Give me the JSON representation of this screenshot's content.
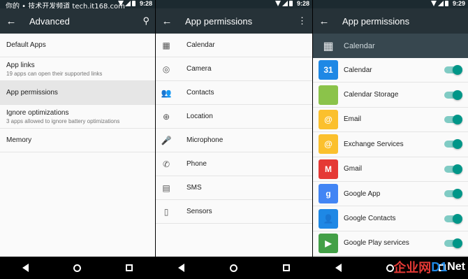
{
  "status": {
    "times": [
      "9:28",
      "9:28",
      "9:29"
    ]
  },
  "watermark": "你的 • 技术开发频道 tech.it168.com",
  "panel1": {
    "title": "Advanced",
    "rows": [
      {
        "title": "Default Apps",
        "sub": ""
      },
      {
        "title": "App links",
        "sub": "19 apps can open their supported links"
      },
      {
        "title": "App permissions",
        "sub": ""
      },
      {
        "title": "Ignore optimizations",
        "sub": "3 apps allowed to ignore battery optimizations"
      },
      {
        "title": "Memory",
        "sub": ""
      }
    ]
  },
  "panel2": {
    "title": "App permissions",
    "rows": [
      "Calendar",
      "Camera",
      "Contacts",
      "Location",
      "Microphone",
      "Phone",
      "SMS",
      "Sensors"
    ]
  },
  "panel3": {
    "title": "App permissions",
    "header": "Calendar",
    "apps": [
      {
        "name": "Calendar",
        "icon": "31",
        "color": "#1e88e5"
      },
      {
        "name": "Calendar Storage",
        "icon": "",
        "color": "#8bc34a"
      },
      {
        "name": "Email",
        "icon": "@",
        "color": "#fbc02d"
      },
      {
        "name": "Exchange Services",
        "icon": "@",
        "color": "#fbc02d"
      },
      {
        "name": "Gmail",
        "icon": "M",
        "color": "#e53935"
      },
      {
        "name": "Google App",
        "icon": "g",
        "color": "#4285f4"
      },
      {
        "name": "Google Contacts",
        "icon": "👤",
        "color": "#1e88e5"
      },
      {
        "name": "Google Play services",
        "icon": "▶",
        "color": "#43a047"
      }
    ]
  },
  "logo": {
    "a": "企业网",
    "b": "D",
    "c": "1",
    "d": "Net"
  }
}
